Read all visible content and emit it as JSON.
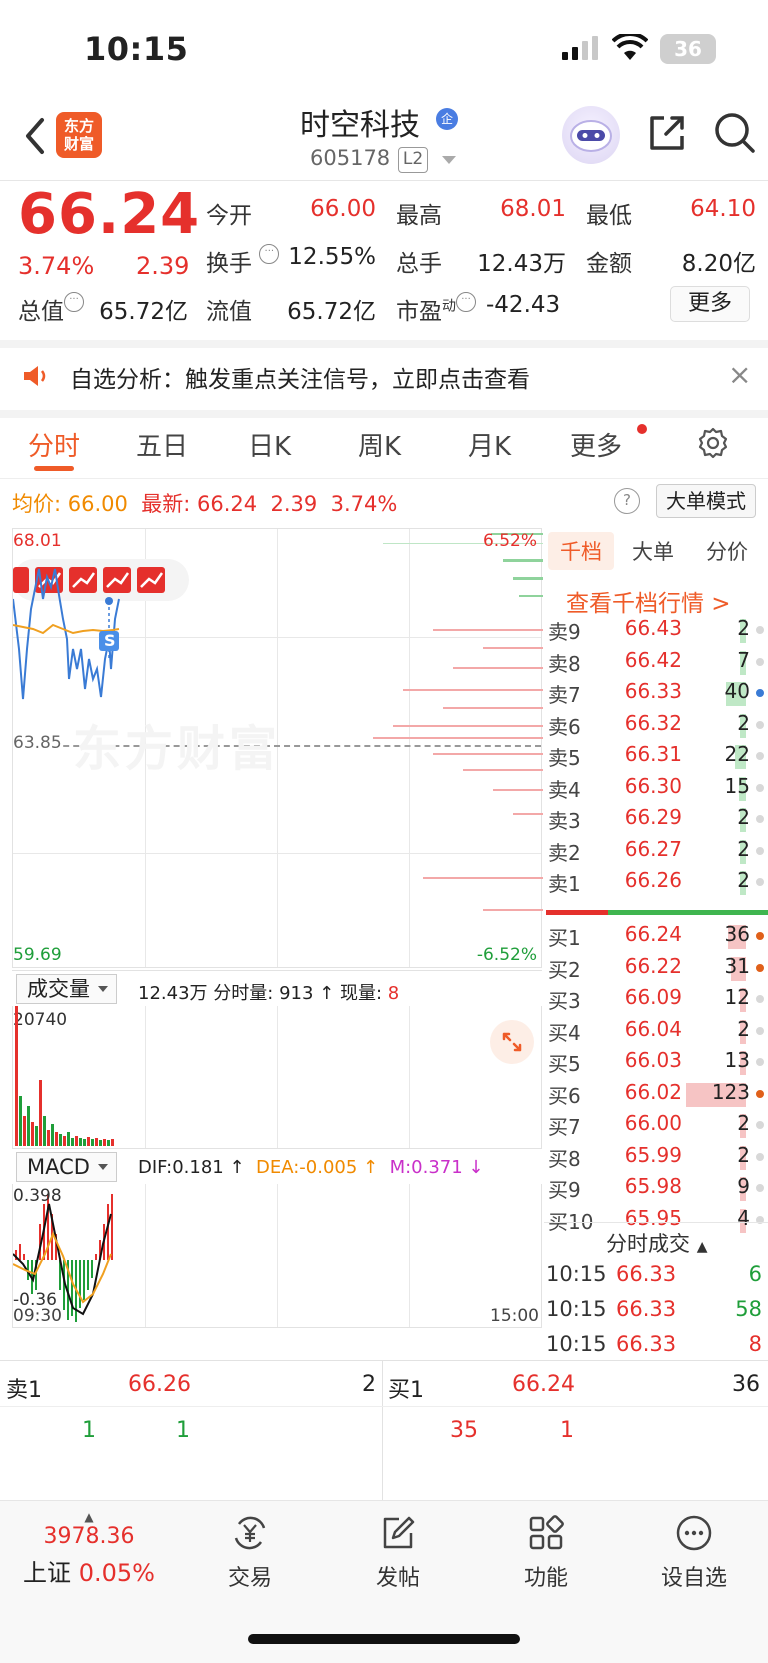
{
  "status_bar": {
    "time": "10:15",
    "battery": "36"
  },
  "header": {
    "logo_text_line1": "东方",
    "logo_text_line2": "财富",
    "stock_name": "时空科技",
    "company_badge": "企",
    "stock_code": "605178",
    "level_badge": "L2"
  },
  "quote": {
    "price": "66.24",
    "change_pct": "3.74%",
    "change": "2.39",
    "fields": [
      {
        "label": "今开",
        "value": "66.00",
        "color": "#e5302c"
      },
      {
        "label": "最高",
        "value": "68.01",
        "color": "#e5302c"
      },
      {
        "label": "最低",
        "value": "64.10",
        "color": "#e5302c"
      },
      {
        "label": "换手",
        "value": "12.55%",
        "color": "#222"
      },
      {
        "label": "总手",
        "value": "12.43万",
        "color": "#222"
      },
      {
        "label": "金额",
        "value": "8.20亿",
        "color": "#222"
      },
      {
        "label": "总值",
        "value": "65.72亿",
        "color": "#222"
      },
      {
        "label": "流值",
        "value": "65.72亿",
        "color": "#222"
      },
      {
        "label": "市盈",
        "value": "-42.43",
        "color": "#222"
      }
    ],
    "pe_superscript": "动",
    "more_label": "更多"
  },
  "notice": {
    "text": "自选分析：触发重点关注信号，立即点击查看",
    "close": "×"
  },
  "tabs": [
    "分时",
    "五日",
    "日K",
    "周K",
    "月K",
    "更多"
  ],
  "avg_row": {
    "avg_label": "均价:",
    "avg_value": "66.00",
    "latest_label": "最新:",
    "latest_value": "66.24",
    "change": "2.39",
    "pct": "3.74%",
    "help": "?",
    "mode_button": "大单模式"
  },
  "chart": {
    "high_price": "68.01",
    "high_pct": "6.52%",
    "low_price": "59.69",
    "low_pct": "-6.52%",
    "prev_close": "63.85",
    "watermark": "东方财富",
    "signal_badge": "S",
    "start_time": "09:30",
    "end_time": "15:00"
  },
  "chart_data": {
    "type": "line",
    "x": [
      "09:30",
      "10:15"
    ],
    "series": [],
    "ylim": [
      59.69,
      68.01
    ]
  },
  "volume": {
    "selector": "成交量",
    "total": "12.43万",
    "tick_label": "分时量:",
    "tick_value": "913",
    "now_label": "现量:",
    "now_value": "8",
    "max": "20740"
  },
  "macd": {
    "selector": "MACD",
    "dif": "DIF:0.181",
    "dea": "DEA:-0.005",
    "m": "M:0.371",
    "top": "0.398",
    "bottom": "-0.36"
  },
  "order_book": {
    "tabs": [
      "千档",
      "大单",
      "分价"
    ],
    "link": "查看千档行情 >",
    "asks": [
      {
        "label": "卖9",
        "price": "66.43",
        "qty": "2"
      },
      {
        "label": "卖8",
        "price": "66.42",
        "qty": "7"
      },
      {
        "label": "卖7",
        "price": "66.33",
        "qty": "40"
      },
      {
        "label": "卖6",
        "price": "66.32",
        "qty": "2"
      },
      {
        "label": "卖5",
        "price": "66.31",
        "qty": "22"
      },
      {
        "label": "卖4",
        "price": "66.30",
        "qty": "15"
      },
      {
        "label": "卖3",
        "price": "66.29",
        "qty": "2"
      },
      {
        "label": "卖2",
        "price": "66.27",
        "qty": "2"
      },
      {
        "label": "卖1",
        "price": "66.26",
        "qty": "2"
      }
    ],
    "bids": [
      {
        "label": "买1",
        "price": "66.24",
        "qty": "36"
      },
      {
        "label": "买2",
        "price": "66.22",
        "qty": "31"
      },
      {
        "label": "买3",
        "price": "66.09",
        "qty": "12"
      },
      {
        "label": "买4",
        "price": "66.04",
        "qty": "2"
      },
      {
        "label": "买5",
        "price": "66.03",
        "qty": "13"
      },
      {
        "label": "买6",
        "price": "66.02",
        "qty": "123"
      },
      {
        "label": "买7",
        "price": "66.00",
        "qty": "2"
      },
      {
        "label": "买8",
        "price": "65.99",
        "qty": "2"
      },
      {
        "label": "买9",
        "price": "65.98",
        "qty": "9"
      },
      {
        "label": "买10",
        "price": "65.95",
        "qty": "4"
      }
    ]
  },
  "time_sales": {
    "title": "分时成交",
    "rows": [
      {
        "time": "10:15",
        "price": "66.33",
        "qty": "6",
        "color": "#1f9e3a"
      },
      {
        "time": "10:15",
        "price": "66.33",
        "qty": "58",
        "color": "#1f9e3a"
      },
      {
        "time": "10:15",
        "price": "66.33",
        "qty": "8",
        "color": "#e5302c"
      }
    ]
  },
  "bottom_book": {
    "ask_label": "卖1",
    "ask_price": "66.26",
    "ask_qty": "2",
    "ask_detail": [
      "1",
      "1"
    ],
    "bid_label": "买1",
    "bid_price": "66.24",
    "bid_qty": "36",
    "bid_detail": [
      "35",
      "1"
    ]
  },
  "nav": {
    "index_value": "3978.36",
    "index_name": "上证",
    "index_pct": "0.05%",
    "items": [
      "交易",
      "发帖",
      "功能",
      "设自选"
    ]
  }
}
